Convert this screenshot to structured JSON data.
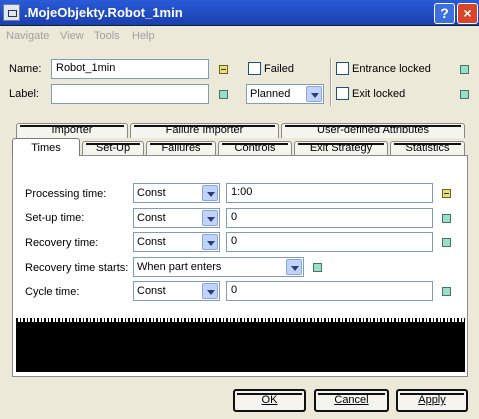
{
  "window": {
    "title": ".MojeObjekty.Robot_1min",
    "help_label": "?",
    "close_label": "×"
  },
  "menu": {
    "items": [
      "Navigate",
      "View",
      "Tools",
      "Help"
    ]
  },
  "header": {
    "name_label": "Name:",
    "name_value": "Robot_1min",
    "label_label": "Label:",
    "label_value": "",
    "failed_label": "Failed",
    "status_value": "Planned",
    "entrance_locked_label": "Entrance locked",
    "exit_locked_label": "Exit locked"
  },
  "tabs": {
    "row1": [
      "Importer",
      "Failure Importer",
      "User-defined Attributes"
    ],
    "row2": [
      "Times",
      "Set-Up",
      "Failures",
      "Controls",
      "Exit Strategy",
      "Statistics"
    ],
    "active": "Times"
  },
  "times": {
    "rows": [
      {
        "label": "Processing time:",
        "dist": "Const",
        "value": "1:00"
      },
      {
        "label": "Set-up time:",
        "dist": "Const",
        "value": "0"
      },
      {
        "label": "Recovery time:",
        "dist": "Const",
        "value": "0"
      },
      {
        "label": "Recovery time starts:",
        "dist": "When part enters",
        "value": ""
      },
      {
        "label": "Cycle time:",
        "dist": "Const",
        "value": "0"
      }
    ]
  },
  "buttons": {
    "ok": "OK",
    "cancel": "Cancel",
    "apply": "Apply"
  },
  "colors": {
    "titlebar": "#1a3fb0",
    "window_bg": "#ece9d8",
    "inherit_marker": "#9fdcc8",
    "changed_marker": "#e9e070"
  }
}
